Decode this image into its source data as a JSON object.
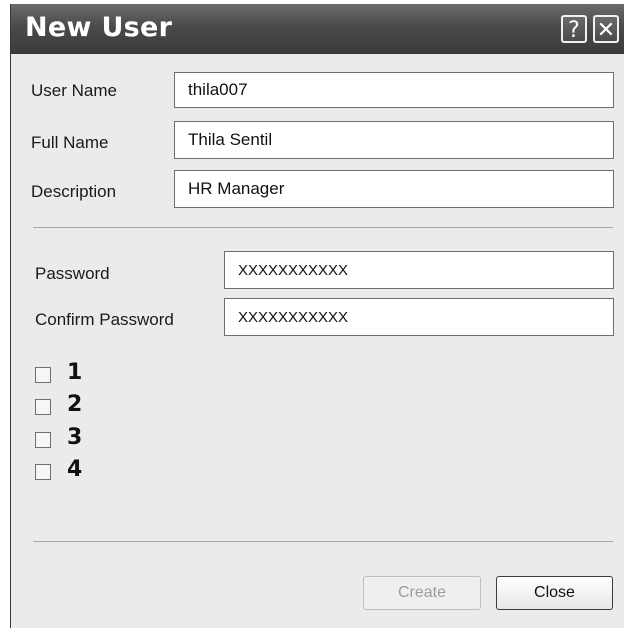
{
  "dialog": {
    "title": "New User",
    "help_label": "?",
    "close_label": "✕"
  },
  "form": {
    "user_name_label": "User Name",
    "user_name_value": "thila007",
    "full_name_label": "Full Name",
    "full_name_value": "Thila Sentil",
    "description_label": "Description",
    "description_value": "HR Manager",
    "password_label": "Password",
    "password_value": "XXXXXXXXXXX",
    "confirm_password_label": "Confirm Password",
    "confirm_password_value": "XXXXXXXXXXX"
  },
  "checkboxes": [
    {
      "label": "1",
      "checked": false
    },
    {
      "label": "2",
      "checked": false
    },
    {
      "label": "3",
      "checked": false
    },
    {
      "label": "4",
      "checked": false
    }
  ],
  "buttons": {
    "create": "Create",
    "create_enabled": false,
    "close": "Close"
  },
  "colors": {
    "titlebar": "#4a4a4a",
    "dialog_bg": "#ebebeb"
  }
}
